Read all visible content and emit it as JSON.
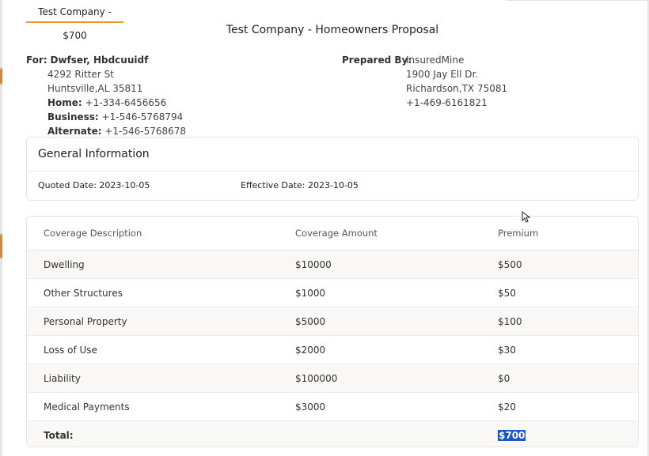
{
  "tab": {
    "label": "Test Company - $700"
  },
  "page_title": "Test Company - Homeowners Proposal",
  "for": {
    "label": "For:",
    "name": "Dwfser, Hbdcuuidf",
    "address1": "4292 Ritter St",
    "address2": "Huntsville,AL 35811",
    "home_label": "Home:",
    "home": "+1-334-6456656",
    "business_label": "Business:",
    "business": "+1-546-5768794",
    "alternate_label": "Alternate:",
    "alternate": "+1-546-5768678"
  },
  "prepared": {
    "label": "Prepared By:",
    "name": "InsuredMine",
    "address1": "1900 Jay Ell Dr.",
    "address2": "Richardson,TX 75081",
    "phone": "+1-469-6161821"
  },
  "general": {
    "title": "General Information",
    "quoted": "Quoted Date: 2023-10-05",
    "effective": "Effective Date: 2023-10-05"
  },
  "coverage": {
    "headers": [
      "Coverage Description",
      "Coverage Amount",
      "Premium"
    ],
    "rows": [
      {
        "desc": "Dwelling",
        "amount": "$10000",
        "premium": "$500"
      },
      {
        "desc": "Other Structures",
        "amount": "$1000",
        "premium": "$50"
      },
      {
        "desc": "Personal Property",
        "amount": "$5000",
        "premium": "$100"
      },
      {
        "desc": "Loss of Use",
        "amount": "$2000",
        "premium": "$30"
      },
      {
        "desc": "Liability",
        "amount": "$100000",
        "premium": "$0"
      },
      {
        "desc": "Medical Payments",
        "amount": "$3000",
        "premium": "$20"
      }
    ],
    "total_label": "Total:",
    "total_value": "$700"
  },
  "colors": {
    "accent": "#f0962f",
    "selection": "#1a56c8"
  }
}
